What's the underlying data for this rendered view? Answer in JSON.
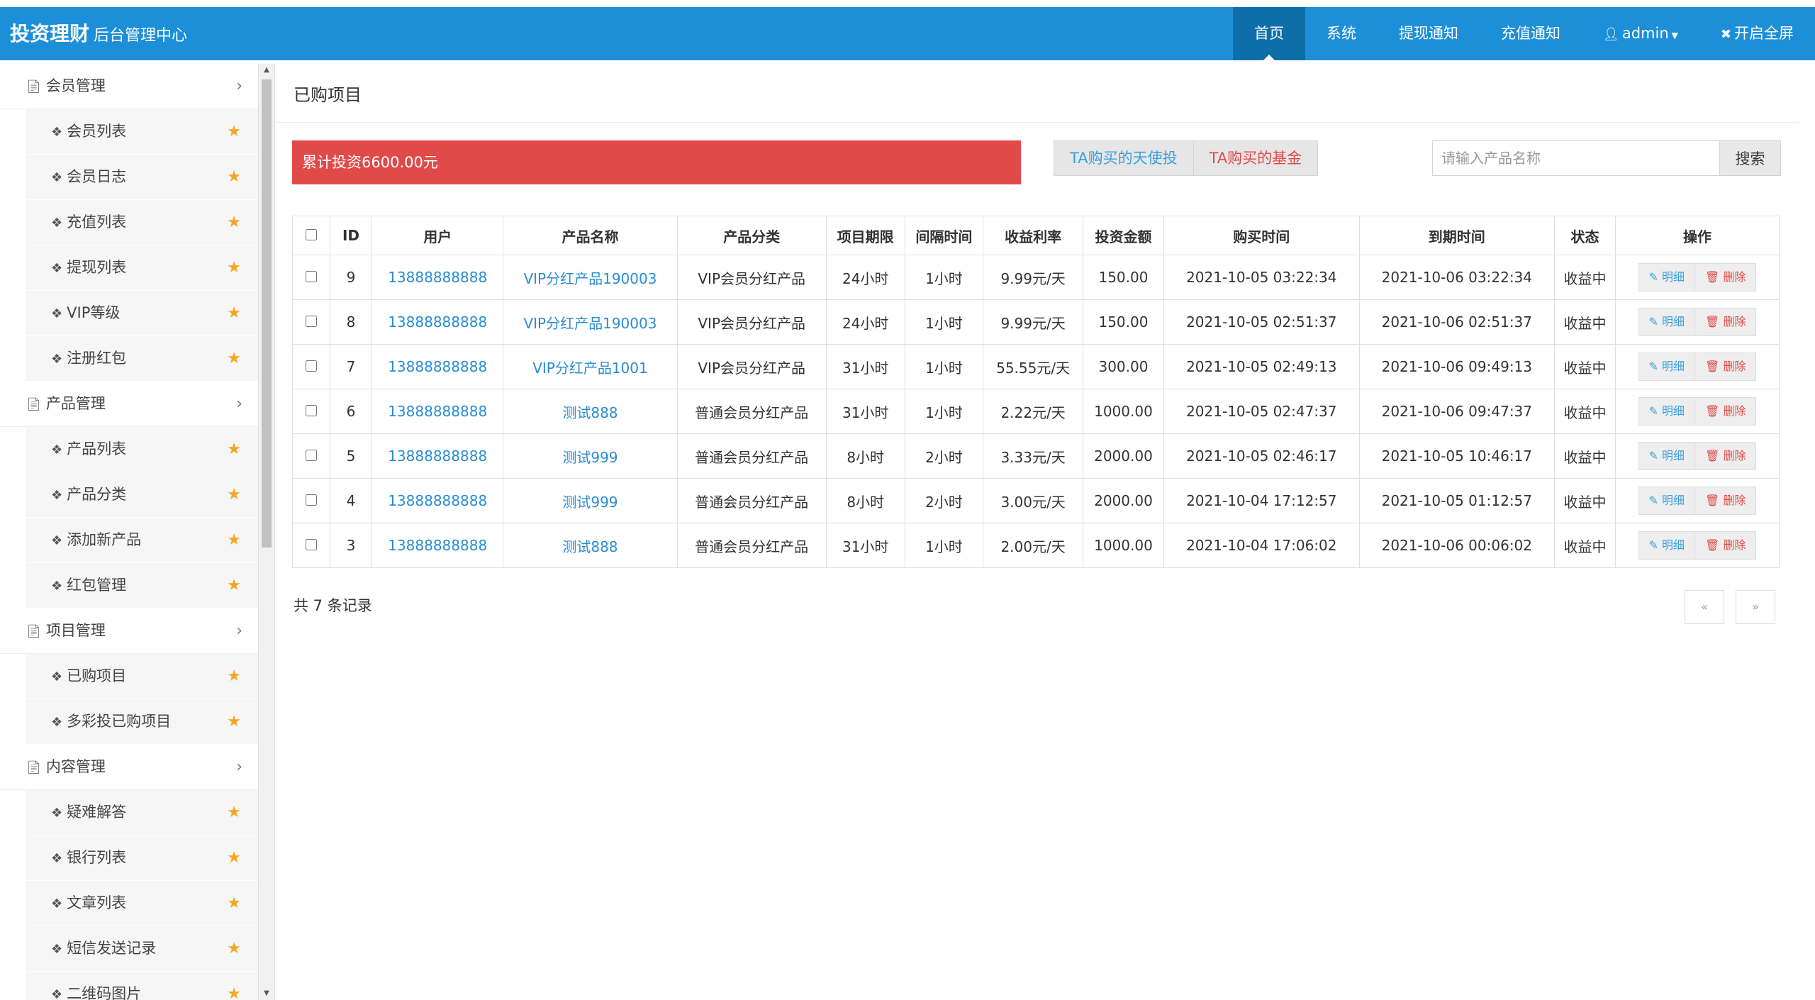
{
  "header": {
    "brand_main": "投资理财",
    "brand_sub": "后台管理中心",
    "nav": [
      {
        "label": "首页",
        "active": true
      },
      {
        "label": "系统"
      },
      {
        "label": "提现通知"
      },
      {
        "label": "充值通知"
      }
    ],
    "user_label": "admin",
    "fullscreen_label": "开启全屏"
  },
  "sidebar": {
    "groups": [
      {
        "label": "会员管理",
        "items": [
          "会员列表",
          "会员日志",
          "充值列表",
          "提现列表",
          "VIP等级",
          "注册红包"
        ]
      },
      {
        "label": "产品管理",
        "items": [
          "产品列表",
          "产品分类",
          "添加新产品",
          "红包管理"
        ]
      },
      {
        "label": "项目管理",
        "items": [
          "已购项目",
          "多彩投已购项目"
        ]
      },
      {
        "label": "内容管理",
        "items": [
          "疑难解答",
          "银行列表",
          "文章列表",
          "短信发送记录",
          "二维码图片"
        ]
      }
    ]
  },
  "main": {
    "title": "已购项目",
    "total_invest": "累计投资6600.00元",
    "tabs": [
      "TA购买的天使投",
      "TA购买的基金"
    ],
    "search": {
      "placeholder": "请输入产品名称",
      "button": "搜索"
    },
    "table": {
      "headers": [
        "ID",
        "用户",
        "产品名称",
        "产品分类",
        "项目期限",
        "间隔时间",
        "收益利率",
        "投资金额",
        "购买时间",
        "到期时间",
        "状态",
        "操作"
      ],
      "rows": [
        [
          "9",
          "13888888888",
          "VIP分红产品190003",
          "VIP会员分红产品",
          "24小时",
          "1小时",
          "9.99元/天",
          "150.00",
          "2021-10-05 03:22:34",
          "2021-10-06 03:22:34",
          "收益中"
        ],
        [
          "8",
          "13888888888",
          "VIP分红产品190003",
          "VIP会员分红产品",
          "24小时",
          "1小时",
          "9.99元/天",
          "150.00",
          "2021-10-05 02:51:37",
          "2021-10-06 02:51:37",
          "收益中"
        ],
        [
          "7",
          "13888888888",
          "VIP分红产品1001",
          "VIP会员分红产品",
          "31小时",
          "1小时",
          "55.55元/天",
          "300.00",
          "2021-10-05 02:49:13",
          "2021-10-06 09:49:13",
          "收益中"
        ],
        [
          "6",
          "13888888888",
          "测试888",
          "普通会员分红产品",
          "31小时",
          "1小时",
          "2.22元/天",
          "1000.00",
          "2021-10-05 02:47:37",
          "2021-10-06 09:47:37",
          "收益中"
        ],
        [
          "5",
          "13888888888",
          "测试999",
          "普通会员分红产品",
          "8小时",
          "2小时",
          "3.33元/天",
          "2000.00",
          "2021-10-05 02:46:17",
          "2021-10-05 10:46:17",
          "收益中"
        ],
        [
          "4",
          "13888888888",
          "测试999",
          "普通会员分红产品",
          "8小时",
          "2小时",
          "3.00元/天",
          "2000.00",
          "2021-10-04 17:12:57",
          "2021-10-05 01:12:57",
          "收益中"
        ],
        [
          "3",
          "13888888888",
          "测试888",
          "普通会员分红产品",
          "31小时",
          "1小时",
          "2.00元/天",
          "1000.00",
          "2021-10-04 17:06:02",
          "2021-10-06 00:06:02",
          "收益中"
        ]
      ],
      "op_detail": "明细",
      "op_delete": "删除"
    },
    "record_count": "共 7 条记录",
    "pager": {
      "prev": "«",
      "next": "»"
    }
  },
  "colors": {
    "header": "#1c8fd8",
    "header_active": "#0e6fa8",
    "danger": "#e04b4a",
    "link": "#2a8cd3",
    "star": "#f5a623"
  }
}
